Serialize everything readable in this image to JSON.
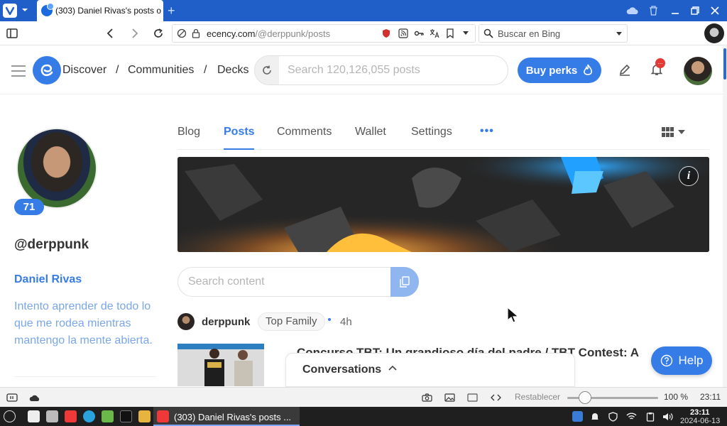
{
  "browser": {
    "tab_title": "(303) Daniel Rivas's posts o",
    "url_host": "ecency.com",
    "url_path": "/@derppunk/posts",
    "search_placeholder": "Buscar en Bing"
  },
  "header": {
    "breadcrumbs": [
      "Discover",
      "/",
      "Communities",
      "/",
      "Decks"
    ],
    "search_placeholder": "Search 120,126,055 posts",
    "buy_perks_label": "Buy perks",
    "notification_badge": "..."
  },
  "profile": {
    "reputation": "71",
    "username": "@derppunk",
    "display_name": "Daniel Rivas",
    "bio": "Intento aprender de todo lo que me rodea mientras mantengo la mente abierta."
  },
  "tabs": {
    "items": [
      "Blog",
      "Posts",
      "Comments",
      "Wallet",
      "Settings"
    ],
    "more": "•••",
    "active": "Posts"
  },
  "cover": {
    "info_label": "i"
  },
  "content_search": {
    "placeholder": "Search content"
  },
  "post": {
    "author": "derppunk",
    "community": "Top Family",
    "time": "4h",
    "title": "Concurso TBT: Un grandioso día del padre / TBT Contest: A"
  },
  "conversations": {
    "label": "Conversations"
  },
  "help": {
    "label": "Help"
  },
  "statusbar": {
    "reset_label": "Restablecer",
    "zoom_level": "100 %",
    "clock": "23:11"
  },
  "taskbar": {
    "task_label": "(303) Daniel Rivas's posts ...",
    "time": "23:11",
    "date": "2024-06-13"
  },
  "colors": {
    "accent": "#357ce6",
    "browser_chrome": "#1f5fc7",
    "taskbar": "#1f1f1f"
  }
}
